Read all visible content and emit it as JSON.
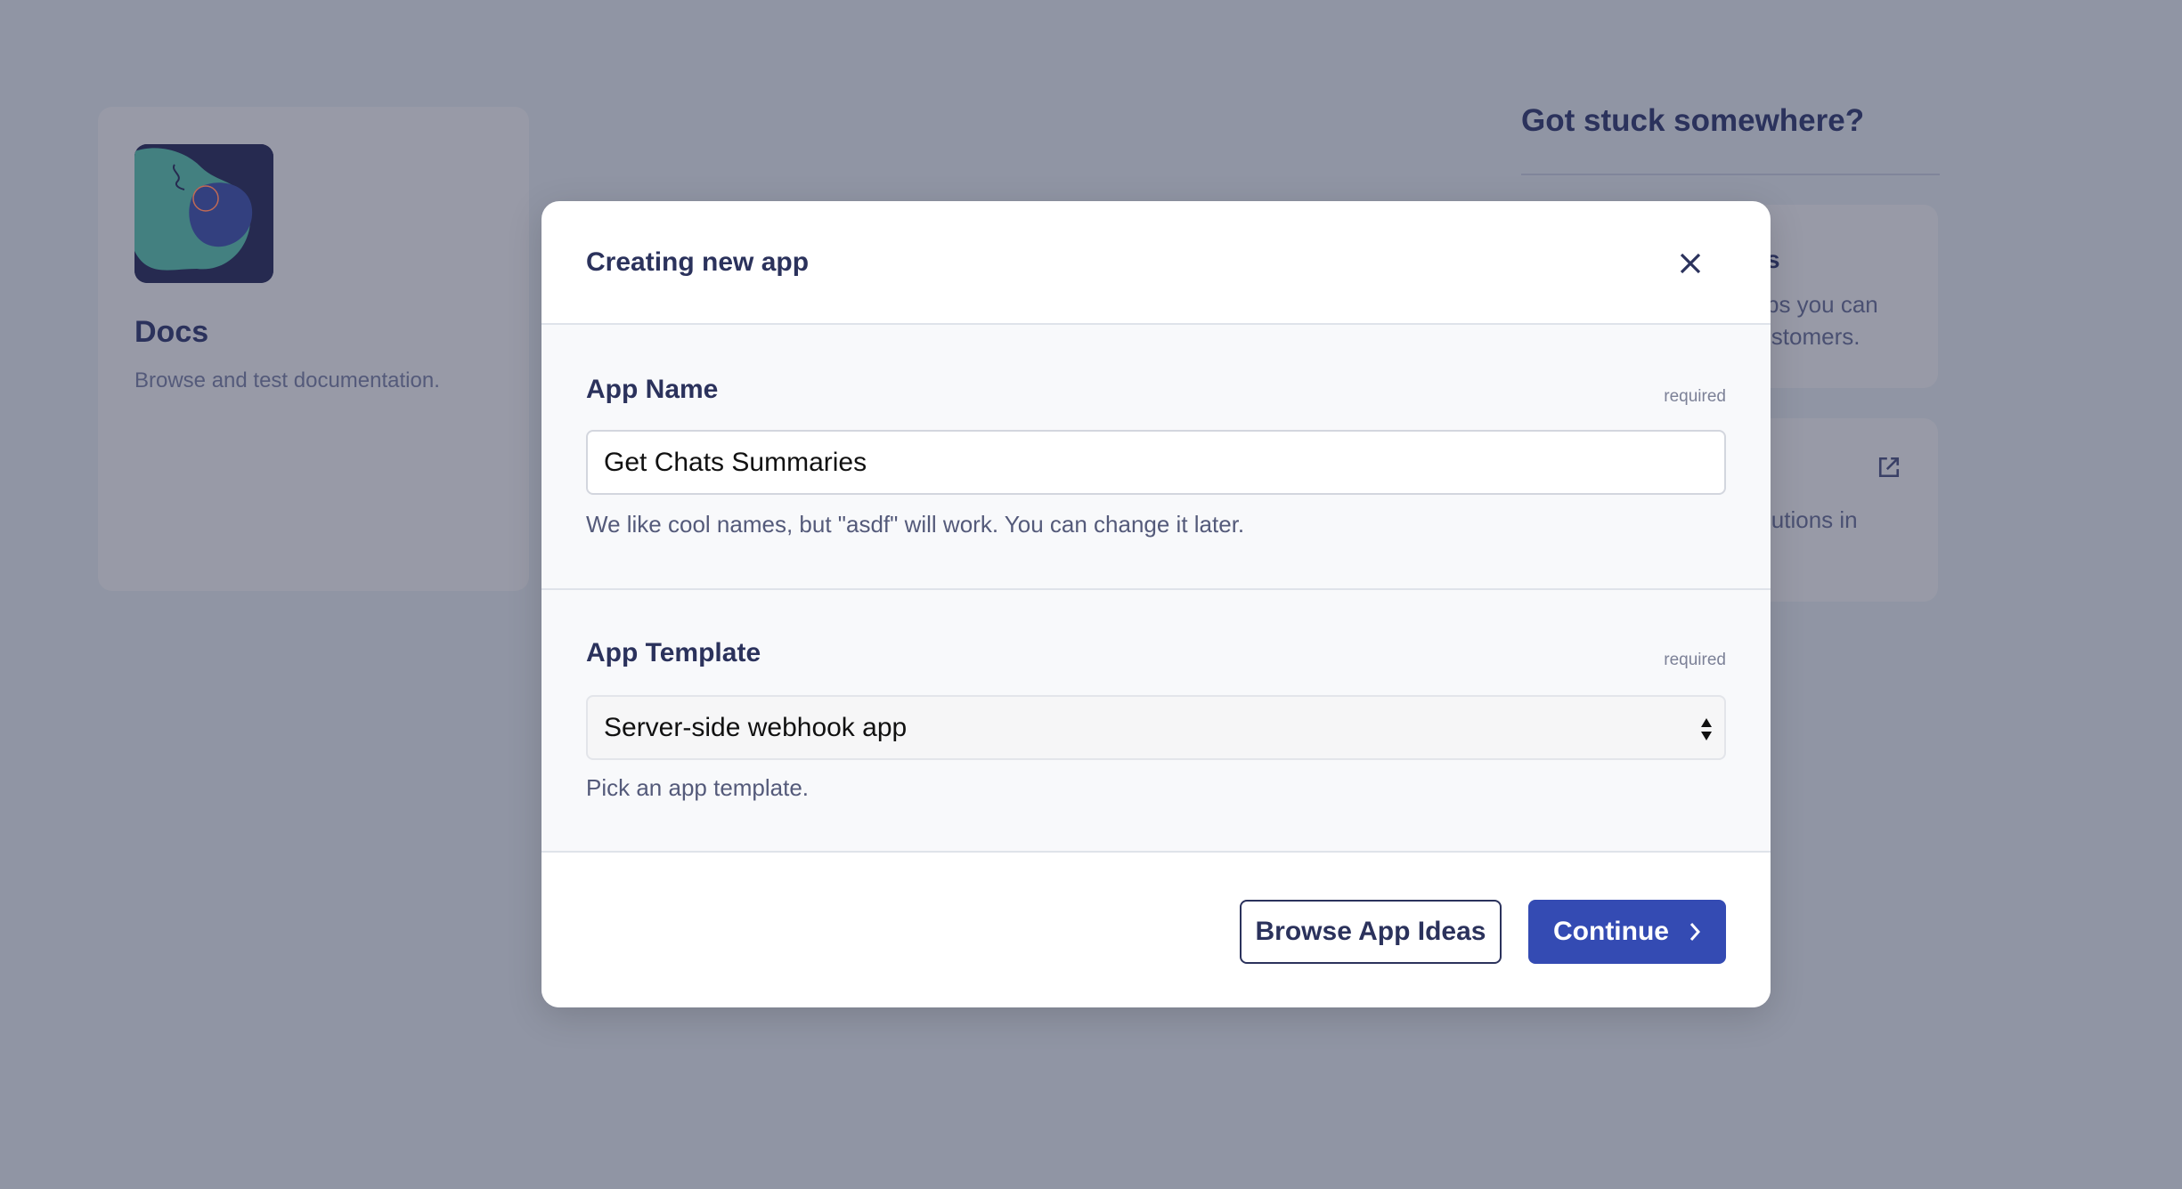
{
  "background": {
    "docs_card": {
      "title": "Docs",
      "description": "Browse and test documentation."
    },
    "help": {
      "title": "Got stuck somewhere?",
      "card1_partial": [
        "s",
        "ps you can",
        "istomers."
      ],
      "card2_partial": [
        "lutions in"
      ]
    }
  },
  "modal": {
    "title": "Creating new app",
    "app_name": {
      "label": "App Name",
      "required": "required",
      "value": "Get Chats Summaries",
      "helper": "We like cool names, but \"asdf\" will work. You can change it later."
    },
    "app_template": {
      "label": "App Template",
      "required": "required",
      "value": "Server-side webhook app",
      "helper": "Pick an app template."
    },
    "buttons": {
      "browse": "Browse App Ideas",
      "continue": "Continue"
    }
  },
  "colors": {
    "primary": "#344bb3",
    "text": "#2b325c",
    "overlay": "#9095a4"
  }
}
